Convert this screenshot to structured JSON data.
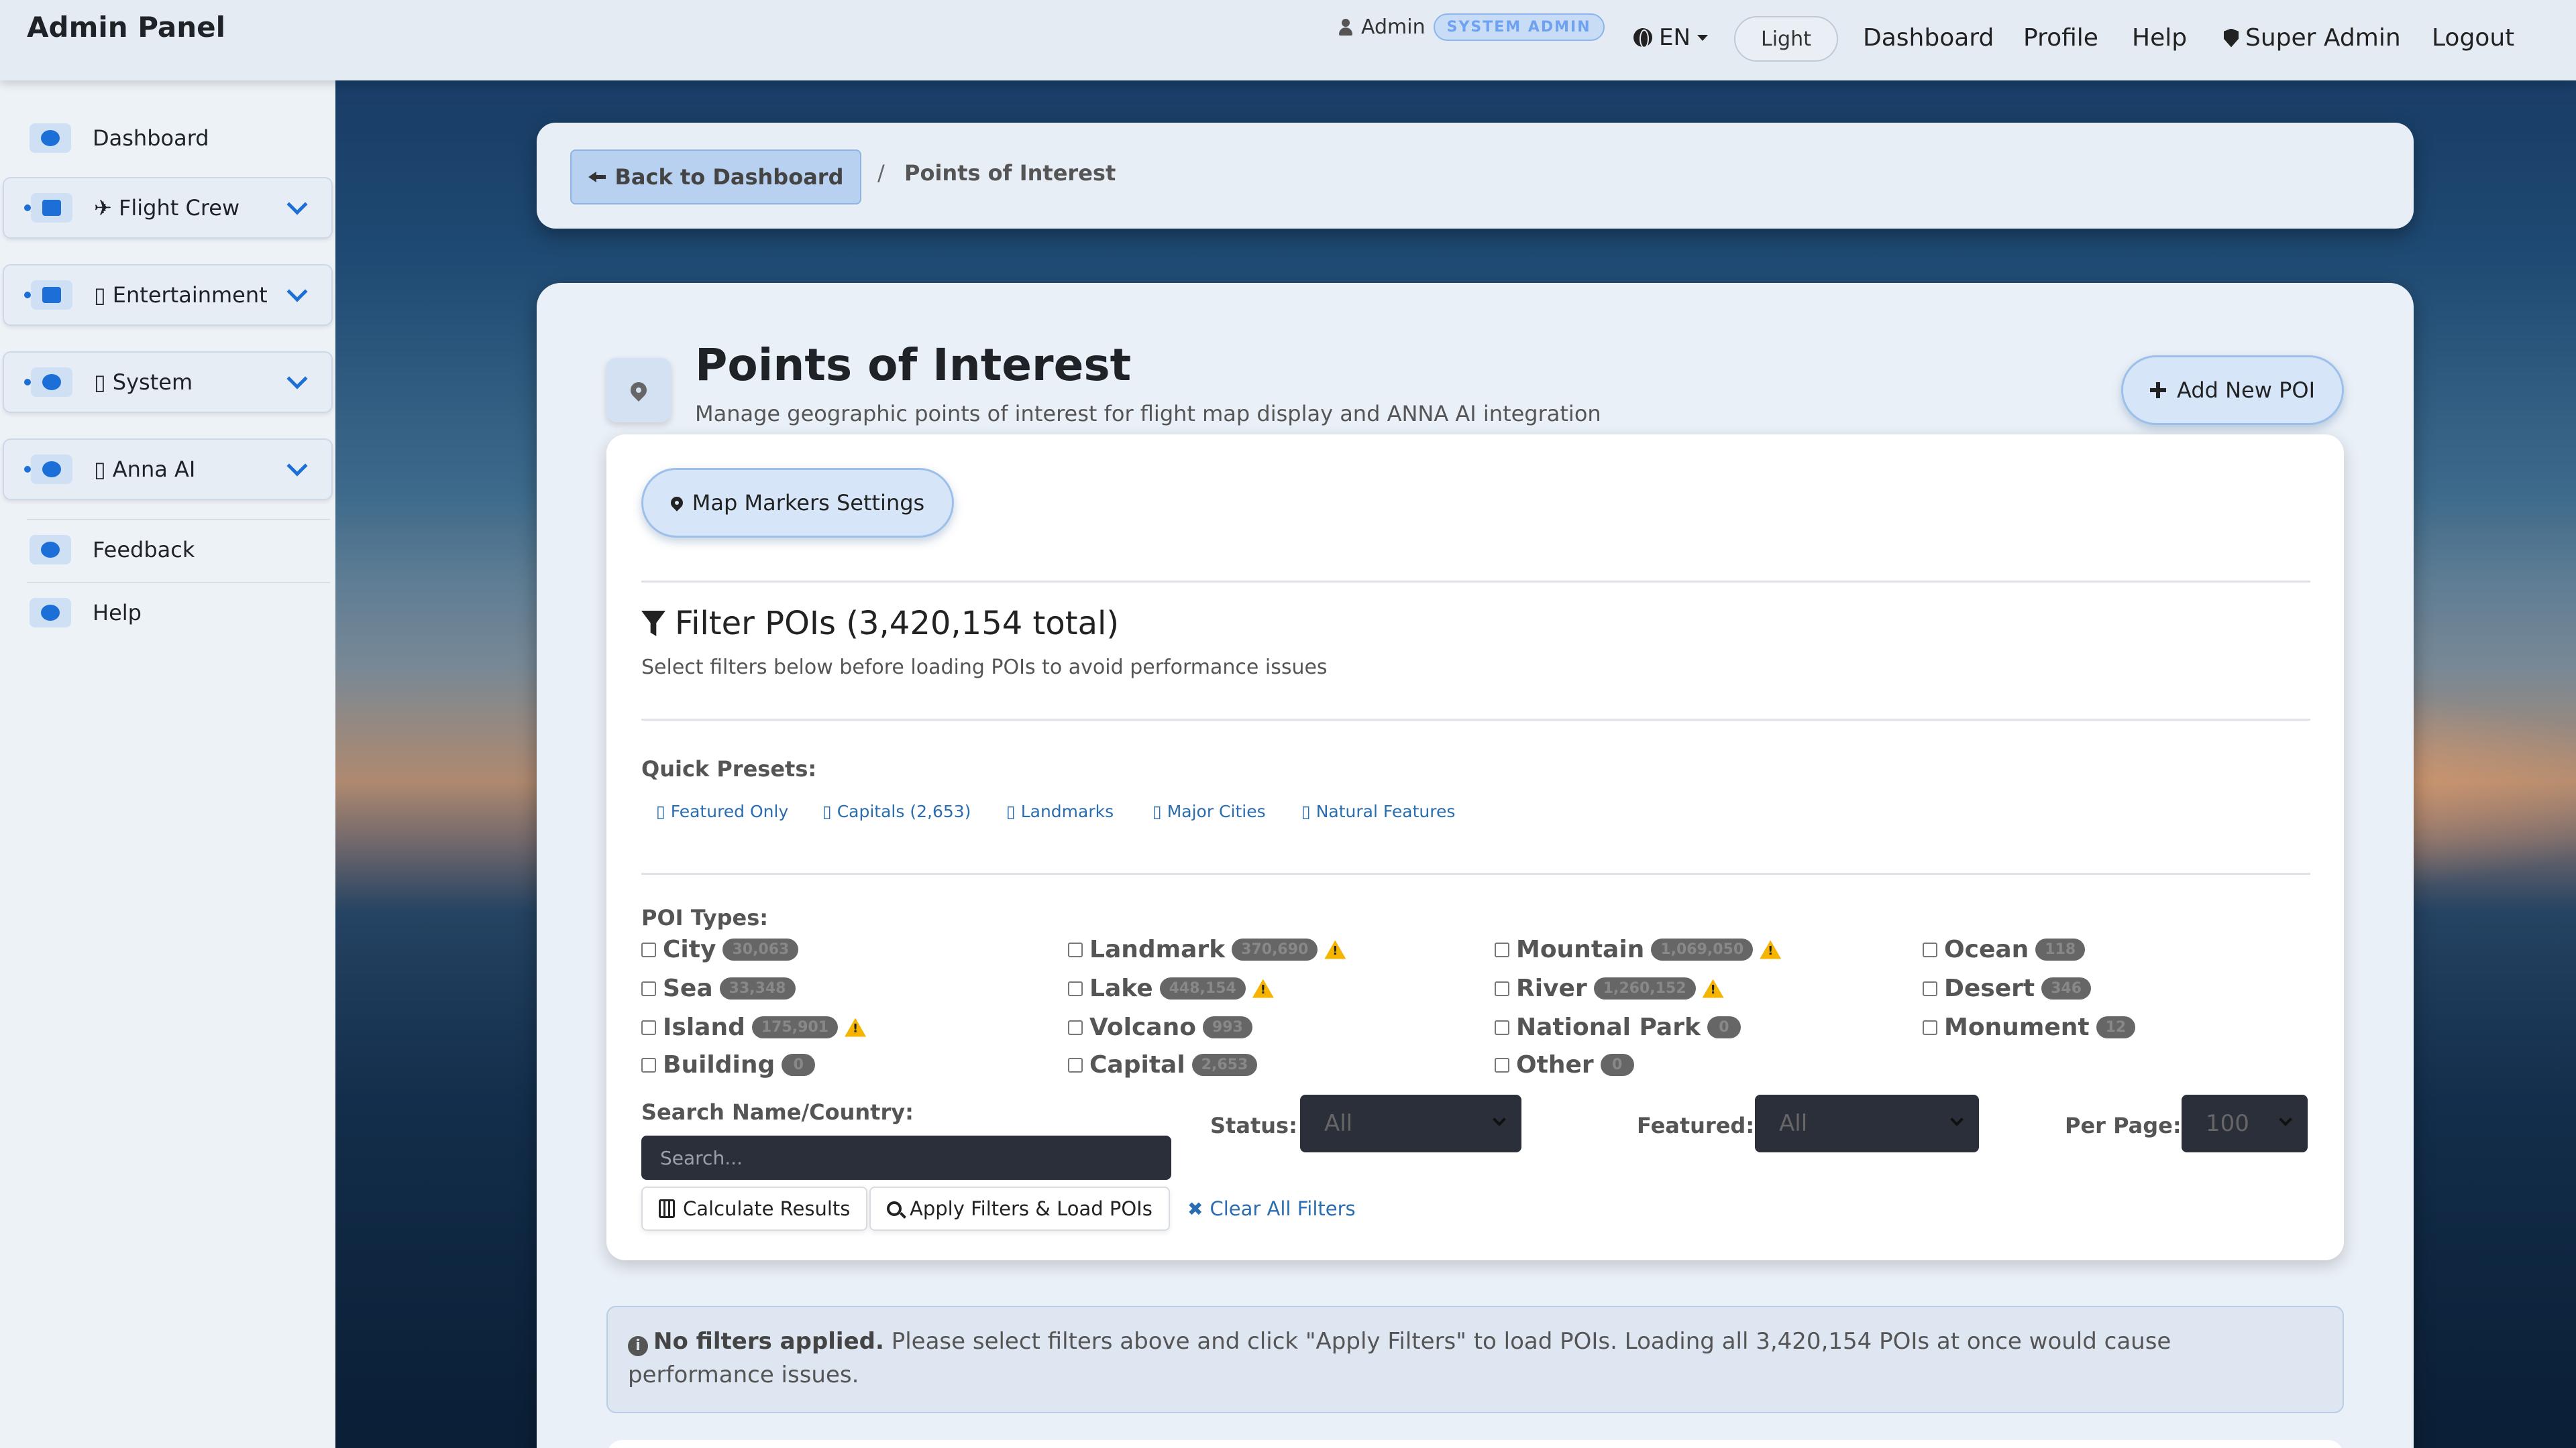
{
  "app": {
    "title": "Admin Panel"
  },
  "topbar": {
    "user_name": "Admin",
    "role_badge": "SYSTEM ADMIN",
    "language": "EN",
    "theme": "Light",
    "nav": {
      "dashboard": "Dashboard",
      "profile": "Profile",
      "help": "Help",
      "super_admin": "Super Admin",
      "logout": "Logout"
    }
  },
  "sidebar": {
    "items": [
      {
        "label": "Dashboard",
        "icon": "dashboard-icon"
      },
      {
        "label": "✈ Flight Crew",
        "icon": "megaphone-icon"
      },
      {
        "label": "▯ Entertainment",
        "icon": "film-icon"
      },
      {
        "label": "▯ System",
        "icon": "gears-icon"
      },
      {
        "label": "▯ Anna AI",
        "icon": "comments-icon"
      },
      {
        "label": "Feedback",
        "icon": "chat-icon"
      },
      {
        "label": "Help",
        "icon": "question-icon"
      }
    ]
  },
  "breadcrumb": {
    "back_label": "Back to Dashboard",
    "separator": "/",
    "current": "Points of Interest"
  },
  "page": {
    "title": "Points of Interest",
    "subtitle": "Manage geographic points of interest for flight map display and ANNA AI integration",
    "add_button": "Add New POI"
  },
  "filters": {
    "markers_button": "Map Markers Settings",
    "heading": "Filter POIs (3,420,154 total)",
    "note": "Select filters below before loading POIs to avoid performance issues",
    "presets_label": "Quick Presets:",
    "presets": [
      "▯ Featured Only",
      "▯ Capitals (2,653)",
      "▯ Landmarks",
      "▯ Major Cities",
      "▯ Natural Features"
    ],
    "types_label": "POI Types:",
    "types": [
      {
        "label": "City",
        "count": "30,063",
        "warning": false
      },
      {
        "label": "Landmark",
        "count": "370,690",
        "warning": true
      },
      {
        "label": "Mountain",
        "count": "1,069,050",
        "warning": true
      },
      {
        "label": "Ocean",
        "count": "118",
        "warning": false
      },
      {
        "label": "Sea",
        "count": "33,348",
        "warning": false
      },
      {
        "label": "Lake",
        "count": "448,154",
        "warning": true
      },
      {
        "label": "River",
        "count": "1,260,152",
        "warning": true
      },
      {
        "label": "Desert",
        "count": "346",
        "warning": false
      },
      {
        "label": "Island",
        "count": "175,901",
        "warning": true
      },
      {
        "label": "Volcano",
        "count": "993",
        "warning": false
      },
      {
        "label": "National Park",
        "count": "0",
        "warning": false
      },
      {
        "label": "Monument",
        "count": "12",
        "warning": false
      },
      {
        "label": "Building",
        "count": "0",
        "warning": false
      },
      {
        "label": "Capital",
        "count": "2,653",
        "warning": false
      },
      {
        "label": "Other",
        "count": "0",
        "warning": false
      }
    ],
    "search_label": "Search Name/Country:",
    "search_placeholder": "Search...",
    "status_label": "Status:",
    "status_value": "All",
    "featured_label": "Featured:",
    "featured_value": "All",
    "per_page_label": "Per Page:",
    "per_page_value": "100",
    "calculate_button": "Calculate Results",
    "apply_button": "Apply Filters & Load POIs",
    "clear_link": "Clear All Filters"
  },
  "alert": {
    "strong": "No filters applied.",
    "text": " Please select filters above and click \"Apply Filters\" to load POIs. Loading all 3,420,154 POIs at once would cause performance issues."
  },
  "colors": {
    "accent": "#1d6fd8",
    "warning": "#f4b400",
    "topbar_bg": "#e4ebf3",
    "input_dark": "#2b2f3a"
  }
}
